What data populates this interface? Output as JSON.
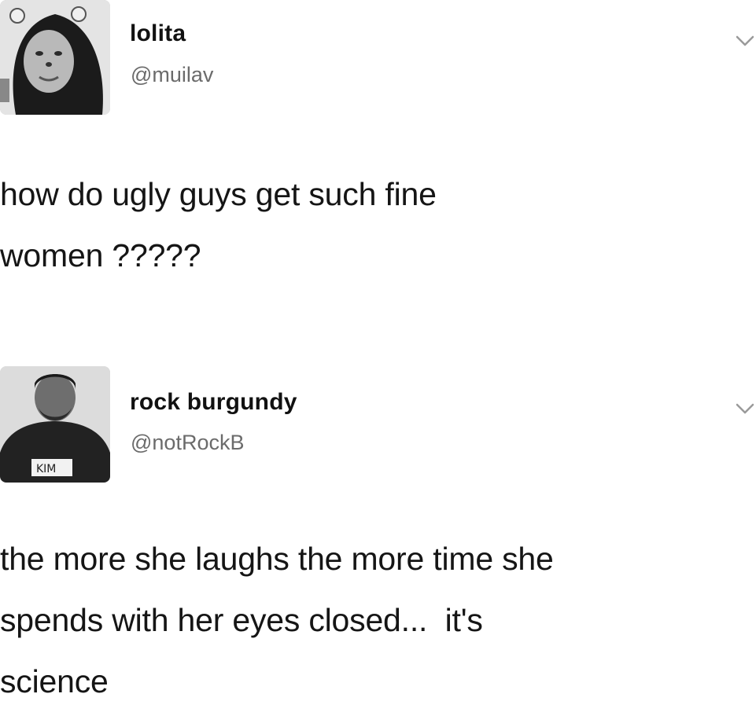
{
  "tweets": [
    {
      "display_name": "lolita",
      "handle": "@muilav",
      "text_lines": [
        "how do ugly guys get such fine",
        "women ?????"
      ],
      "menu_icon": "chevron-down-icon"
    },
    {
      "display_name": "rock burgundy",
      "handle": "@notRockB",
      "text_lines": [
        "the more she laughs the more time she",
        "spends with her eyes closed...  it's",
        "science"
      ],
      "menu_icon": "chevron-down-icon"
    }
  ],
  "colors": {
    "background": "#ffffff",
    "name": "#111111",
    "handle": "#6b6b6b",
    "text": "#151515",
    "chevron": "#9a9a9a"
  }
}
